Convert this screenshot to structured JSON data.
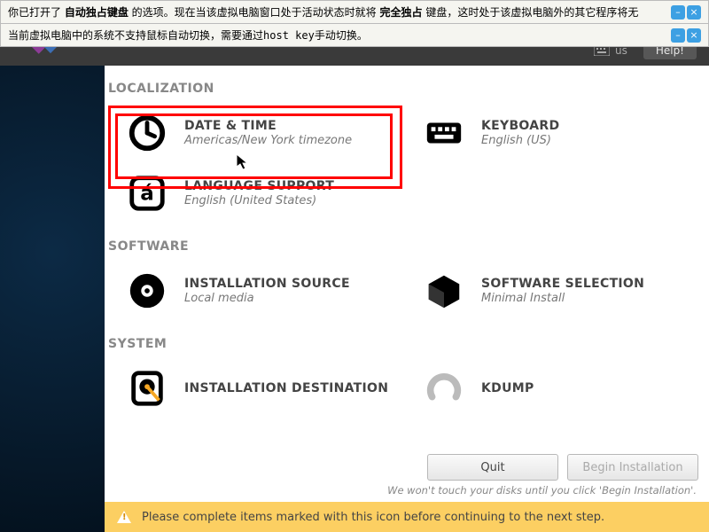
{
  "vbox": {
    "line1_pre": "你已打开了 ",
    "line1_b1": "自动独占键盘",
    "line1_mid": " 的选项。现在当该虚拟电脑窗口处于活动状态时就将 ",
    "line1_b2": "完全独占",
    "line1_post": " 键盘，这时处于该虚拟电脑外的其它程序将无",
    "line2_pre": "当前虚拟电脑中的系统不支持鼠标自动切换，需要通过",
    "line2_code": "host key",
    "line2_post": "手动切换。"
  },
  "topbar": {
    "keyboard_layout": "us",
    "help": "Help!"
  },
  "brand": "CentOS",
  "sections": {
    "localization": "LOCALIZATION",
    "software": "SOFTWARE",
    "system": "SYSTEM"
  },
  "spokes": {
    "datetime": {
      "title": "DATE & TIME",
      "status": "Americas/New York timezone"
    },
    "keyboard": {
      "title": "KEYBOARD",
      "status": "English (US)"
    },
    "language": {
      "title": "LANGUAGE SUPPORT",
      "status": "English (United States)"
    },
    "source": {
      "title": "INSTALLATION SOURCE",
      "status": "Local media"
    },
    "swsel": {
      "title": "SOFTWARE SELECTION",
      "status": "Minimal Install"
    },
    "dest": {
      "title": "INSTALLATION DESTINATION",
      "status": ""
    },
    "kdump": {
      "title": "KDUMP",
      "status": ""
    }
  },
  "buttons": {
    "quit": "Quit",
    "begin": "Begin Installation"
  },
  "hint": "We won't touch your disks until you click 'Begin Installation'.",
  "warning": "Please complete items marked with this icon before continuing to the next step."
}
